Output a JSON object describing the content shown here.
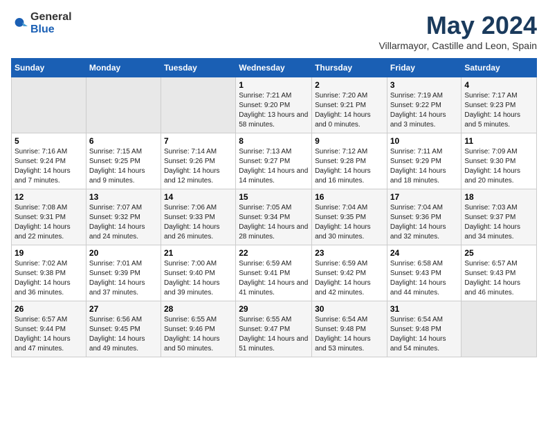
{
  "header": {
    "logo_general": "General",
    "logo_blue": "Blue",
    "title": "May 2024",
    "subtitle": "Villarmayor, Castille and Leon, Spain"
  },
  "days_of_week": [
    "Sunday",
    "Monday",
    "Tuesday",
    "Wednesday",
    "Thursday",
    "Friday",
    "Saturday"
  ],
  "weeks": [
    [
      {
        "day": "",
        "info": ""
      },
      {
        "day": "",
        "info": ""
      },
      {
        "day": "",
        "info": ""
      },
      {
        "day": "1",
        "info": "Sunrise: 7:21 AM\nSunset: 9:20 PM\nDaylight: 13 hours and 58 minutes."
      },
      {
        "day": "2",
        "info": "Sunrise: 7:20 AM\nSunset: 9:21 PM\nDaylight: 14 hours and 0 minutes."
      },
      {
        "day": "3",
        "info": "Sunrise: 7:19 AM\nSunset: 9:22 PM\nDaylight: 14 hours and 3 minutes."
      },
      {
        "day": "4",
        "info": "Sunrise: 7:17 AM\nSunset: 9:23 PM\nDaylight: 14 hours and 5 minutes."
      }
    ],
    [
      {
        "day": "5",
        "info": "Sunrise: 7:16 AM\nSunset: 9:24 PM\nDaylight: 14 hours and 7 minutes."
      },
      {
        "day": "6",
        "info": "Sunrise: 7:15 AM\nSunset: 9:25 PM\nDaylight: 14 hours and 9 minutes."
      },
      {
        "day": "7",
        "info": "Sunrise: 7:14 AM\nSunset: 9:26 PM\nDaylight: 14 hours and 12 minutes."
      },
      {
        "day": "8",
        "info": "Sunrise: 7:13 AM\nSunset: 9:27 PM\nDaylight: 14 hours and 14 minutes."
      },
      {
        "day": "9",
        "info": "Sunrise: 7:12 AM\nSunset: 9:28 PM\nDaylight: 14 hours and 16 minutes."
      },
      {
        "day": "10",
        "info": "Sunrise: 7:11 AM\nSunset: 9:29 PM\nDaylight: 14 hours and 18 minutes."
      },
      {
        "day": "11",
        "info": "Sunrise: 7:09 AM\nSunset: 9:30 PM\nDaylight: 14 hours and 20 minutes."
      }
    ],
    [
      {
        "day": "12",
        "info": "Sunrise: 7:08 AM\nSunset: 9:31 PM\nDaylight: 14 hours and 22 minutes."
      },
      {
        "day": "13",
        "info": "Sunrise: 7:07 AM\nSunset: 9:32 PM\nDaylight: 14 hours and 24 minutes."
      },
      {
        "day": "14",
        "info": "Sunrise: 7:06 AM\nSunset: 9:33 PM\nDaylight: 14 hours and 26 minutes."
      },
      {
        "day": "15",
        "info": "Sunrise: 7:05 AM\nSunset: 9:34 PM\nDaylight: 14 hours and 28 minutes."
      },
      {
        "day": "16",
        "info": "Sunrise: 7:04 AM\nSunset: 9:35 PM\nDaylight: 14 hours and 30 minutes."
      },
      {
        "day": "17",
        "info": "Sunrise: 7:04 AM\nSunset: 9:36 PM\nDaylight: 14 hours and 32 minutes."
      },
      {
        "day": "18",
        "info": "Sunrise: 7:03 AM\nSunset: 9:37 PM\nDaylight: 14 hours and 34 minutes."
      }
    ],
    [
      {
        "day": "19",
        "info": "Sunrise: 7:02 AM\nSunset: 9:38 PM\nDaylight: 14 hours and 36 minutes."
      },
      {
        "day": "20",
        "info": "Sunrise: 7:01 AM\nSunset: 9:39 PM\nDaylight: 14 hours and 37 minutes."
      },
      {
        "day": "21",
        "info": "Sunrise: 7:00 AM\nSunset: 9:40 PM\nDaylight: 14 hours and 39 minutes."
      },
      {
        "day": "22",
        "info": "Sunrise: 6:59 AM\nSunset: 9:41 PM\nDaylight: 14 hours and 41 minutes."
      },
      {
        "day": "23",
        "info": "Sunrise: 6:59 AM\nSunset: 9:42 PM\nDaylight: 14 hours and 42 minutes."
      },
      {
        "day": "24",
        "info": "Sunrise: 6:58 AM\nSunset: 9:43 PM\nDaylight: 14 hours and 44 minutes."
      },
      {
        "day": "25",
        "info": "Sunrise: 6:57 AM\nSunset: 9:43 PM\nDaylight: 14 hours and 46 minutes."
      }
    ],
    [
      {
        "day": "26",
        "info": "Sunrise: 6:57 AM\nSunset: 9:44 PM\nDaylight: 14 hours and 47 minutes."
      },
      {
        "day": "27",
        "info": "Sunrise: 6:56 AM\nSunset: 9:45 PM\nDaylight: 14 hours and 49 minutes."
      },
      {
        "day": "28",
        "info": "Sunrise: 6:55 AM\nSunset: 9:46 PM\nDaylight: 14 hours and 50 minutes."
      },
      {
        "day": "29",
        "info": "Sunrise: 6:55 AM\nSunset: 9:47 PM\nDaylight: 14 hours and 51 minutes."
      },
      {
        "day": "30",
        "info": "Sunrise: 6:54 AM\nSunset: 9:48 PM\nDaylight: 14 hours and 53 minutes."
      },
      {
        "day": "31",
        "info": "Sunrise: 6:54 AM\nSunset: 9:48 PM\nDaylight: 14 hours and 54 minutes."
      },
      {
        "day": "",
        "info": ""
      }
    ]
  ]
}
